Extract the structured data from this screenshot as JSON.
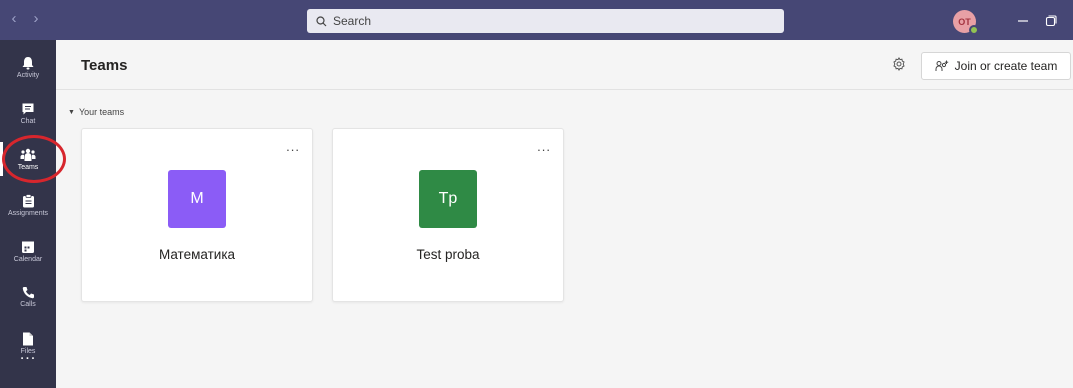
{
  "titlebar": {
    "back_icon": "chevron-left-icon",
    "forward_icon": "chevron-right-icon",
    "search_placeholder": "Search",
    "avatar_initials": "OT",
    "status_color": "#92c353",
    "bar_color": "#464775"
  },
  "rail": {
    "items": [
      {
        "label": "Activity",
        "icon": "bell-icon"
      },
      {
        "label": "Chat",
        "icon": "chat-icon"
      },
      {
        "label": "Teams",
        "icon": "teams-icon",
        "active": true
      },
      {
        "label": "Assignments",
        "icon": "assignments-icon"
      },
      {
        "label": "Calendar",
        "icon": "calendar-icon"
      },
      {
        "label": "Calls",
        "icon": "phone-icon"
      },
      {
        "label": "Files",
        "icon": "file-icon"
      }
    ],
    "more": "...",
    "highlight_color": "#d7262d"
  },
  "header": {
    "title": "Teams",
    "join_label": "Join or create team"
  },
  "section": {
    "label": "Your teams"
  },
  "teams": [
    {
      "initials": "M",
      "name": "Математика",
      "color": "#8b5cf6",
      "menu": "..."
    },
    {
      "initials": "Tp",
      "name": "Test proba",
      "color": "#2f8a45",
      "menu": "..."
    }
  ]
}
